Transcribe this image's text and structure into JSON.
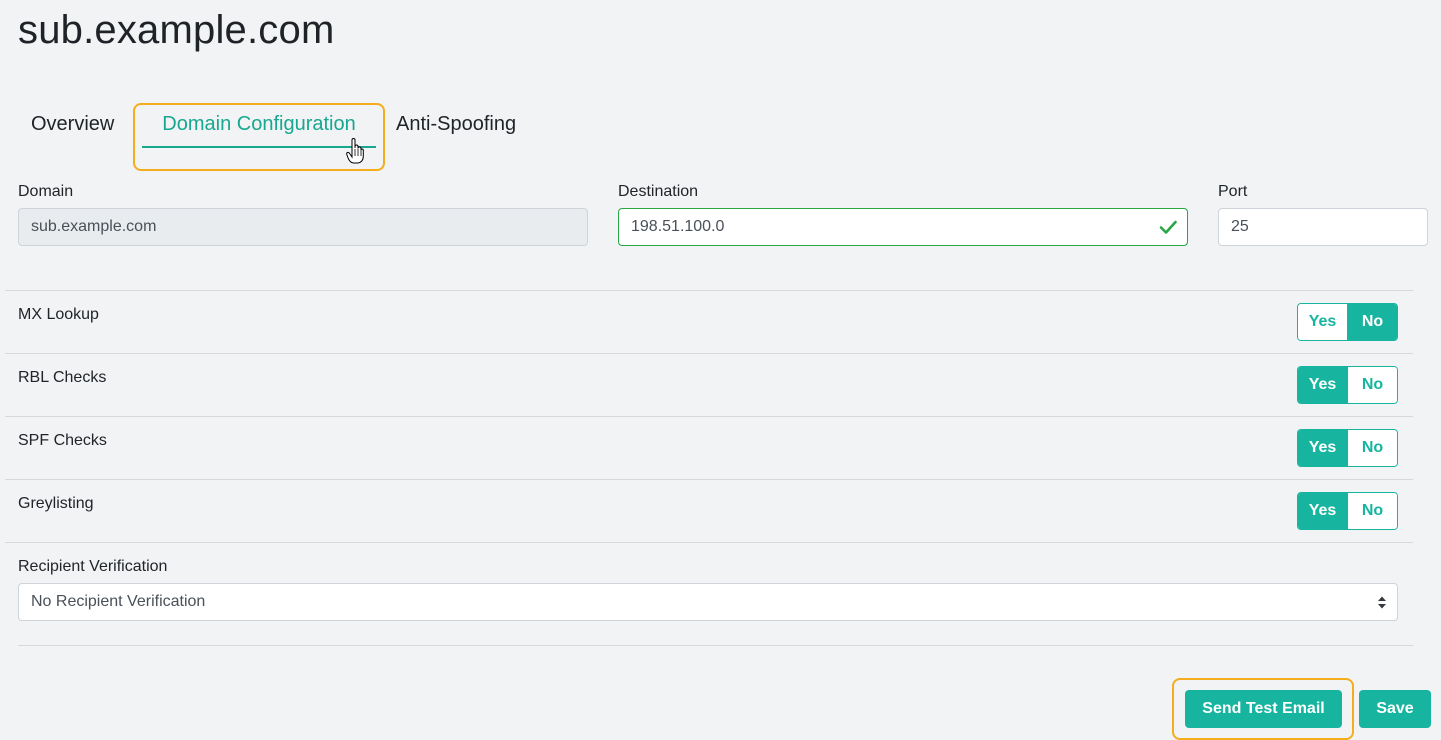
{
  "page": {
    "title": "sub.example.com"
  },
  "tabs": [
    {
      "label": "Overview",
      "active": false
    },
    {
      "label": "Domain Configuration",
      "active": true
    },
    {
      "label": "Anti-Spoofing",
      "active": false
    }
  ],
  "fields": {
    "domain": {
      "label": "Domain",
      "value": "sub.example.com",
      "disabled": true
    },
    "destination": {
      "label": "Destination",
      "value": "198.51.100.0",
      "valid": true
    },
    "port": {
      "label": "Port",
      "value": "25"
    }
  },
  "toggles": [
    {
      "label": "MX Lookup",
      "yes": "Yes",
      "no": "No",
      "selected": "No"
    },
    {
      "label": "RBL Checks",
      "yes": "Yes",
      "no": "No",
      "selected": "Yes"
    },
    {
      "label": "SPF Checks",
      "yes": "Yes",
      "no": "No",
      "selected": "Yes"
    },
    {
      "label": "Greylisting",
      "yes": "Yes",
      "no": "No",
      "selected": "Yes"
    }
  ],
  "recipient_verification": {
    "label": "Recipient Verification",
    "selected": "No Recipient Verification"
  },
  "actions": {
    "send_test": "Send Test Email",
    "save": "Save"
  },
  "colors": {
    "accent": "#17b5a0",
    "highlight": "#f4ad1c",
    "valid": "#28a745"
  }
}
